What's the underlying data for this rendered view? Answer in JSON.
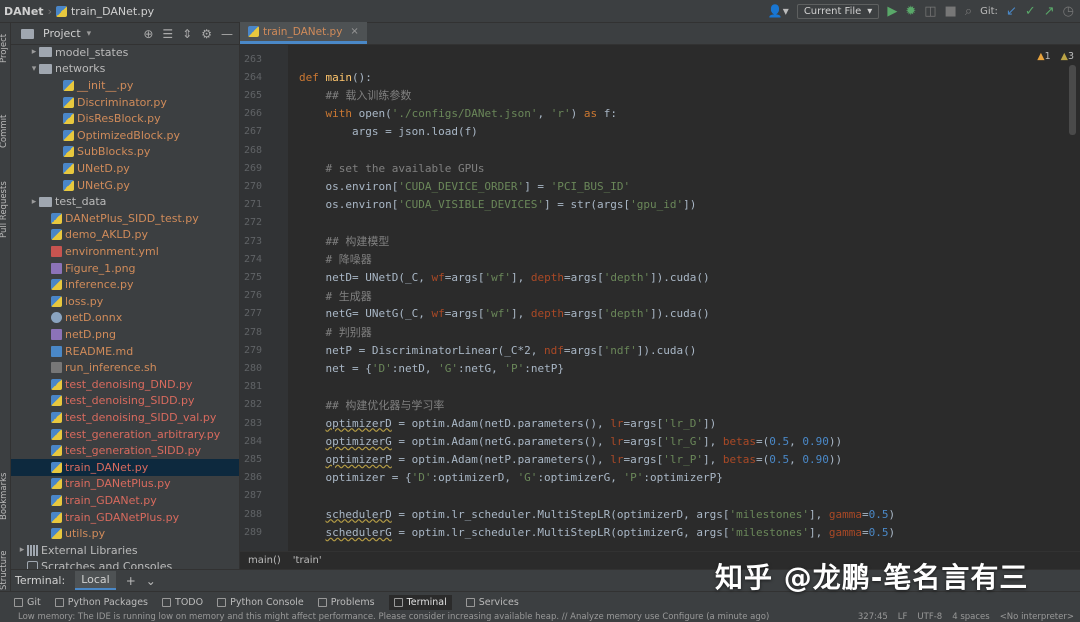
{
  "navbar": {
    "project": "DANet",
    "file": "train_DANet.py",
    "run_config": "Current File",
    "git_label": "Git:"
  },
  "left_strip": {
    "project": "Project",
    "commit": "Commit",
    "pull_requests": "Pull Requests",
    "bookmarks": "Bookmarks",
    "structure": "Structure"
  },
  "project_panel": {
    "title": "Project",
    "items": [
      {
        "name": "model_states",
        "indent": 2,
        "type": "folder",
        "color": "plain",
        "arrow": "▸"
      },
      {
        "name": "networks",
        "indent": 2,
        "type": "folder",
        "color": "plain",
        "arrow": "▾"
      },
      {
        "name": "__init__.py",
        "indent": 4,
        "type": "py",
        "color": "orange",
        "arrow": ""
      },
      {
        "name": "Discriminator.py",
        "indent": 4,
        "type": "py",
        "color": "orange",
        "arrow": ""
      },
      {
        "name": "DisResBlock.py",
        "indent": 4,
        "type": "py",
        "color": "orange",
        "arrow": ""
      },
      {
        "name": "OptimizedBlock.py",
        "indent": 4,
        "type": "py",
        "color": "orange",
        "arrow": ""
      },
      {
        "name": "SubBlocks.py",
        "indent": 4,
        "type": "py",
        "color": "orange",
        "arrow": ""
      },
      {
        "name": "UNetD.py",
        "indent": 4,
        "type": "py",
        "color": "orange",
        "arrow": ""
      },
      {
        "name": "UNetG.py",
        "indent": 4,
        "type": "py",
        "color": "orange",
        "arrow": ""
      },
      {
        "name": "test_data",
        "indent": 2,
        "type": "folder",
        "color": "plain",
        "arrow": "▸"
      },
      {
        "name": "DANetPlus_SIDD_test.py",
        "indent": 3,
        "type": "py",
        "color": "orange",
        "arrow": ""
      },
      {
        "name": "demo_AKLD.py",
        "indent": 3,
        "type": "py",
        "color": "orange",
        "arrow": ""
      },
      {
        "name": "environment.yml",
        "indent": 3,
        "type": "yml",
        "color": "orange",
        "arrow": ""
      },
      {
        "name": "Figure_1.png",
        "indent": 3,
        "type": "png",
        "color": "orange",
        "arrow": ""
      },
      {
        "name": "inference.py",
        "indent": 3,
        "type": "py",
        "color": "orange",
        "arrow": ""
      },
      {
        "name": "loss.py",
        "indent": 3,
        "type": "py",
        "color": "orange",
        "arrow": ""
      },
      {
        "name": "netD.onnx",
        "indent": 3,
        "type": "onnx",
        "color": "orange",
        "arrow": ""
      },
      {
        "name": "netD.png",
        "indent": 3,
        "type": "png",
        "color": "orange",
        "arrow": ""
      },
      {
        "name": "README.md",
        "indent": 3,
        "type": "md",
        "color": "orange",
        "arrow": ""
      },
      {
        "name": "run_inference.sh",
        "indent": 3,
        "type": "sh",
        "color": "orange",
        "arrow": ""
      },
      {
        "name": "test_denoising_DND.py",
        "indent": 3,
        "type": "py",
        "color": "red",
        "arrow": ""
      },
      {
        "name": "test_denoising_SIDD.py",
        "indent": 3,
        "type": "py",
        "color": "red",
        "arrow": ""
      },
      {
        "name": "test_denoising_SIDD_val.py",
        "indent": 3,
        "type": "py",
        "color": "red",
        "arrow": ""
      },
      {
        "name": "test_generation_arbitrary.py",
        "indent": 3,
        "type": "py",
        "color": "red",
        "arrow": ""
      },
      {
        "name": "test_generation_SIDD.py",
        "indent": 3,
        "type": "py",
        "color": "red",
        "arrow": ""
      },
      {
        "name": "train_DANet.py",
        "indent": 3,
        "type": "py",
        "color": "red",
        "arrow": "",
        "selected": true
      },
      {
        "name": "train_DANetPlus.py",
        "indent": 3,
        "type": "py",
        "color": "red",
        "arrow": ""
      },
      {
        "name": "train_GDANet.py",
        "indent": 3,
        "type": "py",
        "color": "red",
        "arrow": ""
      },
      {
        "name": "train_GDANetPlus.py",
        "indent": 3,
        "type": "py",
        "color": "red",
        "arrow": ""
      },
      {
        "name": "utils.py",
        "indent": 3,
        "type": "py",
        "color": "orange",
        "arrow": ""
      },
      {
        "name": "External Libraries",
        "indent": 1,
        "type": "lib",
        "color": "plain",
        "arrow": "▸"
      },
      {
        "name": "Scratches and Consoles",
        "indent": 1,
        "type": "scratch",
        "color": "plain",
        "arrow": ""
      }
    ]
  },
  "editor": {
    "tab": "train_DANet.py",
    "warnings": "1",
    "weak_warnings": "3",
    "lines": [
      {
        "n": "263",
        "html": ""
      },
      {
        "n": "264",
        "html": "<span class='kw'>def</span> <span class='fn'>main</span>():"
      },
      {
        "n": "265",
        "html": "    <span class='cm'>## 载入训练参数</span>"
      },
      {
        "n": "266",
        "html": "    <span class='kw'>with</span> open(<span class='str'>'./configs/DANet.json'</span>, <span class='str'>'r'</span>) <span class='kw'>as</span> f:"
      },
      {
        "n": "267",
        "html": "        args = json.load(f)"
      },
      {
        "n": "268",
        "html": ""
      },
      {
        "n": "269",
        "html": "    <span class='cm'># set the available GPUs</span>"
      },
      {
        "n": "270",
        "html": "    os.environ[<span class='str'>'CUDA_DEVICE_ORDER'</span>] = <span class='str'>'PCI_BUS_ID'</span>"
      },
      {
        "n": "271",
        "html": "    os.environ[<span class='str'>'CUDA_VISIBLE_DEVICES'</span>] = str(args[<span class='str'>'gpu_id'</span>])"
      },
      {
        "n": "272",
        "html": ""
      },
      {
        "n": "273",
        "html": "    <span class='cm'>## 构建模型</span>"
      },
      {
        "n": "274",
        "html": "    <span class='cm'># 降噪器</span>"
      },
      {
        "n": "275",
        "html": "    netD= UNetD(_C, <span class='prm'>wf</span>=args[<span class='str'>'wf'</span>], <span class='prm'>depth</span>=args[<span class='str'>'depth'</span>]).cuda()"
      },
      {
        "n": "276",
        "html": "    <span class='cm'># 生成器</span>"
      },
      {
        "n": "277",
        "html": "    netG= UNetG(_C, <span class='prm'>wf</span>=args[<span class='str'>'wf'</span>], <span class='prm'>depth</span>=args[<span class='str'>'depth'</span>]).cuda()"
      },
      {
        "n": "278",
        "html": "    <span class='cm'># 判别器</span>"
      },
      {
        "n": "279",
        "html": "    netP = DiscriminatorLinear(_C*2, <span class='prm'>ndf</span>=args[<span class='str'>'ndf'</span>]).cuda()"
      },
      {
        "n": "280",
        "html": "    net = {<span class='str'>'D'</span>:netD, <span class='str'>'G'</span>:netG, <span class='str'>'P'</span>:netP}"
      },
      {
        "n": "281",
        "html": ""
      },
      {
        "n": "282",
        "html": "    <span class='cm'>## 构建优化器与学习率</span>"
      },
      {
        "n": "283",
        "html": "    <span class='warn-under'>optimizerD</span> = optim.Adam(netD.parameters(), <span class='prm'>lr</span>=args[<span class='str'>'lr_D'</span>])"
      },
      {
        "n": "284",
        "html": "    <span class='warn-under'>optimizerG</span> = optim.Adam(netG.parameters(), <span class='prm'>lr</span>=args[<span class='str'>'lr_G'</span>], <span class='prm'>betas</span>=(<span class='blue'>0.5</span>, <span class='blue'>0.90</span>))"
      },
      {
        "n": "285",
        "html": "    <span class='warn-under'>optimizerP</span> = optim.Adam(netP.parameters(), <span class='prm'>lr</span>=args[<span class='str'>'lr_P'</span>], <span class='prm'>betas</span>=(<span class='blue'>0.5</span>, <span class='blue'>0.90</span>))"
      },
      {
        "n": "286",
        "html": "    optimizer = {<span class='str'>'D'</span>:optimizerD, <span class='str'>'G'</span>:optimizerG, <span class='str'>'P'</span>:optimizerP}"
      },
      {
        "n": "287",
        "html": ""
      },
      {
        "n": "288",
        "html": "    <span class='warn-under'>schedulerD</span> = optim.lr_scheduler.MultiStepLR(optimizerD, args[<span class='str'>'milestones'</span>], <span class='prm'>gamma</span>=<span class='blue'>0.5</span>)"
      },
      {
        "n": "289",
        "html": "    <span class='warn-under'>schedulerG</span> = optim.lr_scheduler.MultiStepLR(optimizerG, args[<span class='str'>'milestones'</span>], <span class='prm'>gamma</span>=<span class='blue'>0.5</span>)"
      }
    ]
  },
  "breadcrumb": {
    "fn": "main()",
    "key": "'train'"
  },
  "terminal": {
    "title": "Terminal:",
    "tab": "Local",
    "add": "+",
    "more": "⌄"
  },
  "bottom_tools": [
    "Git",
    "Python Packages",
    "TODO",
    "Python Console",
    "Problems",
    "Terminal",
    "Services"
  ],
  "status": {
    "message": "Low memory: The IDE is running low on memory and this might affect performance. Please consider increasing available heap. // Analyze memory use   Configure (a minute ago)",
    "position": "327:45",
    "line_sep": "LF",
    "encoding": "UTF-8",
    "indent": "4 spaces",
    "interpreter": "<No interpreter>"
  },
  "watermark": "知乎 @龙鹏-笔名言有三"
}
